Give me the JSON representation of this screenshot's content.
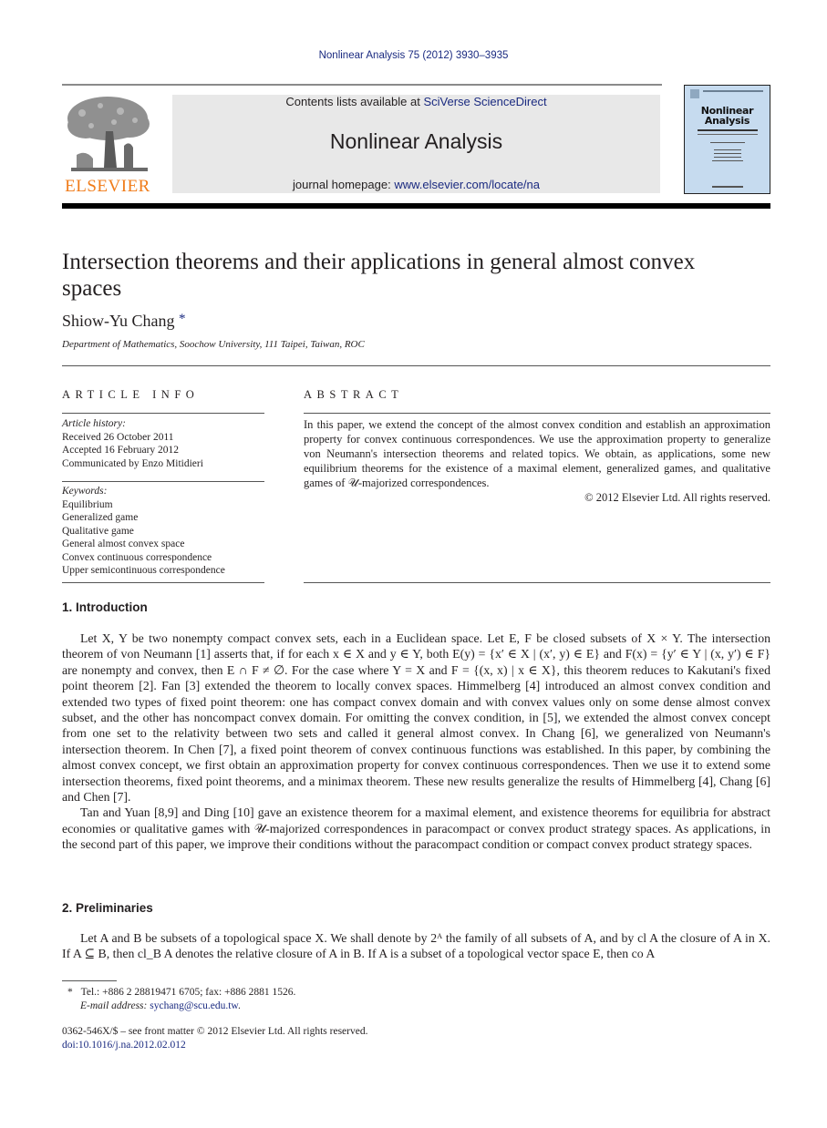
{
  "header": {
    "journal_ref": "Nonlinear Analysis 75 (2012) 3930–3935",
    "contents_prefix": "Contents lists available at ",
    "contents_link": "SciVerse ScienceDirect",
    "journal_title": "Nonlinear Analysis",
    "homepage_prefix": "journal homepage: ",
    "homepage_link": "www.elsevier.com/locate/na",
    "publisher_logo": "ELSEVIER",
    "cover_title_line1": "Nonlinear",
    "cover_title_line2": "Analysis",
    "colors": {
      "publisher_orange": "#f07c1a",
      "link_blue": "#1a2a80",
      "banner_gray": "#e8e8e8",
      "cover_blue": "#c6dbef"
    }
  },
  "article": {
    "title": "Intersection theorems and their applications in general almost convex spaces",
    "author": "Shiow-Yu Chang",
    "author_mark": "*",
    "affiliation": "Department of Mathematics, Soochow University, 111 Taipei, Taiwan, ROC"
  },
  "article_info": {
    "heading": "ARTICLE INFO",
    "history_label": "Article history:",
    "history": [
      "Received 26 October 2011",
      "Accepted 16 February 2012",
      "Communicated by Enzo Mitidieri"
    ],
    "keywords_label": "Keywords:",
    "keywords": [
      "Equilibrium",
      "Generalized game",
      "Qualitative game",
      "General almost convex space",
      "Convex continuous correspondence",
      "Upper semicontinuous correspondence"
    ]
  },
  "abstract": {
    "heading": "ABSTRACT",
    "text": "In this paper, we extend the concept of the almost convex condition and establish an approximation property for convex continuous correspondences. We use the approximation property to generalize von Neumann's intersection theorems and related topics. We obtain, as applications, some new equilibrium theorems for the existence of a maximal element, generalized games, and qualitative games of 𝒰-majorized correspondences.",
    "copyright": "© 2012 Elsevier Ltd. All rights reserved."
  },
  "sections": [
    {
      "heading": "1.  Introduction",
      "paragraphs": [
        "Let X, Y be two nonempty compact convex sets, each in a Euclidean space. Let E, F be closed subsets of X × Y. The intersection theorem of von Neumann [1] asserts that, if for each x ∈ X and y ∈ Y, both E(y) = {x′ ∈ X | (x′, y) ∈ E} and F(x) = {y′ ∈ Y | (x, y′) ∈ F} are nonempty and convex, then E ∩ F ≠ ∅. For the case where Y = X and F = {(x, x) | x ∈ X}, this theorem reduces to Kakutani's fixed point theorem [2]. Fan [3] extended the theorem to locally convex spaces. Himmelberg [4] introduced an almost convex condition and extended two types of fixed point theorem: one has compact convex domain and with convex values only on some dense almost convex subset, and the other has noncompact convex domain. For omitting the convex condition, in [5], we extended the almost convex concept from one set to the relativity between two sets and called it general almost convex. In Chang [6], we generalized von Neumann's intersection theorem. In Chen [7], a fixed point theorem of convex continuous functions was established. In this paper, by combining the almost convex concept, we first obtain an approximation property for convex continuous correspondences. Then we use it to extend some intersection theorems, fixed point theorems, and a minimax theorem. These new results generalize the results of Himmelberg [4], Chang [6] and Chen [7].",
        "Tan and Yuan [8,9] and Ding [10] gave an existence theorem for a maximal element, and existence theorems for equilibria for abstract economies or qualitative games with 𝒰-majorized correspondences in paracompact or convex product strategy spaces. As applications, in the second part of this paper, we improve their conditions without the paracompact condition or compact convex product strategy spaces."
      ]
    },
    {
      "heading": "2.  Preliminaries",
      "paragraphs": [
        "Let A and B be subsets of a topological space X. We shall denote by 2ᴬ the family of all subsets of A, and by cl A the closure of A in X. If A ⊆ B, then cl_B A denotes the relative closure of A in B. If A is a subset of a topological vector space E, then co A"
      ]
    }
  ],
  "footnote": {
    "mark": "*",
    "contact": "Tel.: +886 2 28819471 6705; fax: +886 2881 1526.",
    "email_label": "E-mail address:",
    "email": "sychang@scu.edu.tw"
  },
  "front_matter": {
    "issn_line": "0362-546X/$ – see front matter © 2012 Elsevier Ltd. All rights reserved.",
    "doi": "doi:10.1016/j.na.2012.02.012"
  }
}
